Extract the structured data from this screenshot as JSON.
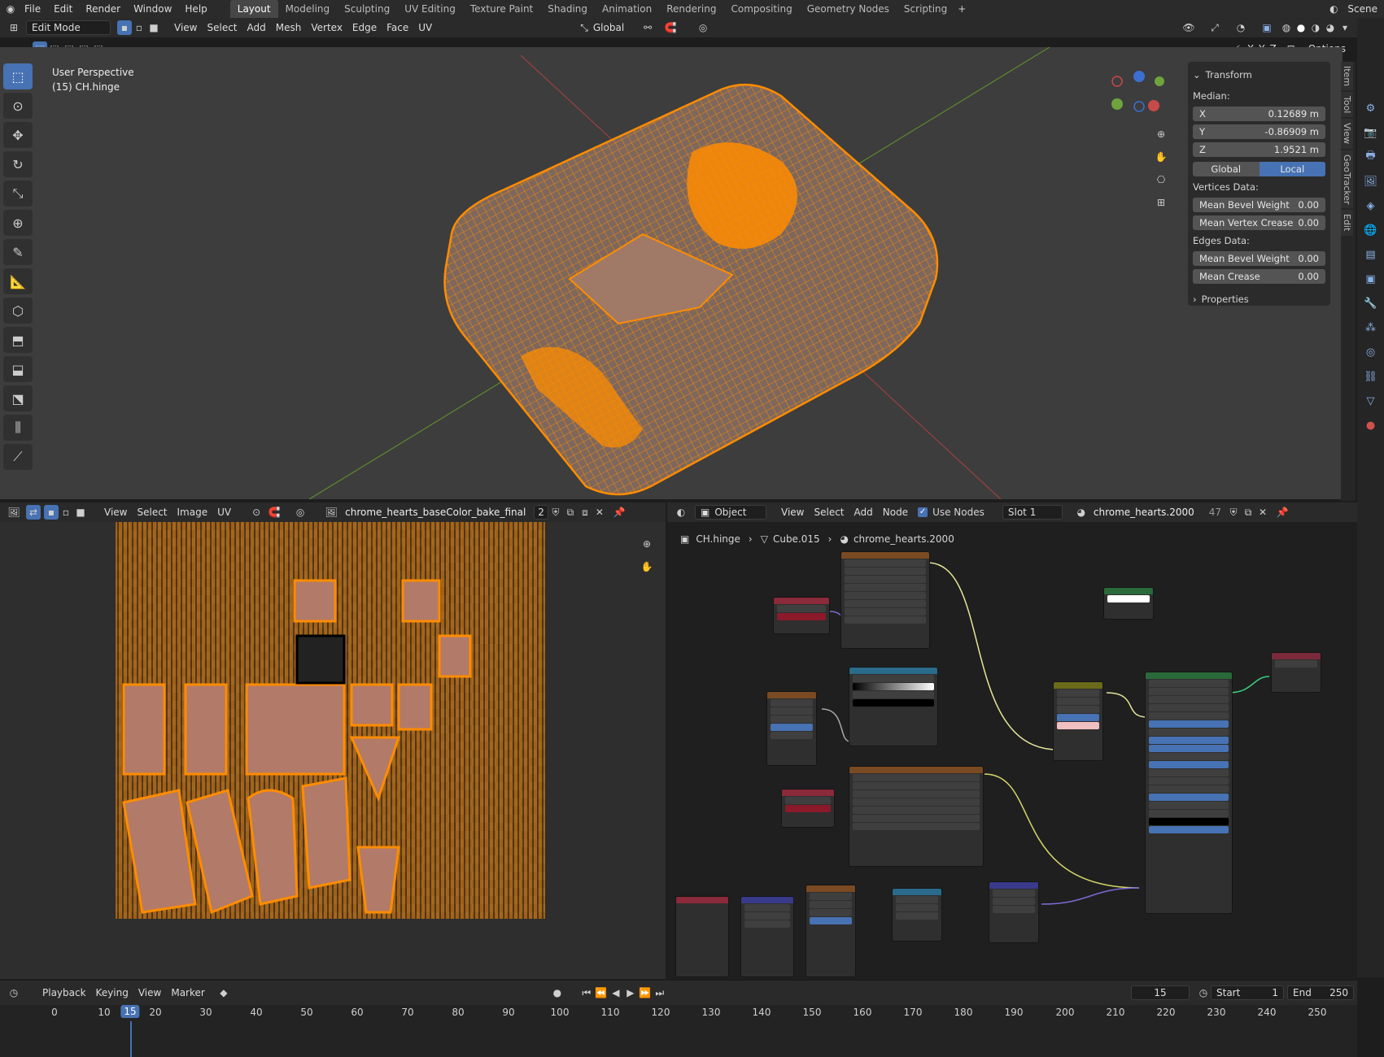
{
  "top_menu": [
    "File",
    "Edit",
    "Render",
    "Window",
    "Help"
  ],
  "workspaces": [
    {
      "label": "Layout",
      "active": true
    },
    {
      "label": "Modeling"
    },
    {
      "label": "Sculpting"
    },
    {
      "label": "UV Editing"
    },
    {
      "label": "Texture Paint"
    },
    {
      "label": "Shading"
    },
    {
      "label": "Animation"
    },
    {
      "label": "Rendering"
    },
    {
      "label": "Compositing"
    },
    {
      "label": "Geometry Nodes"
    },
    {
      "label": "Scripting"
    }
  ],
  "scene_label": "Scene",
  "viewport": {
    "mode": "Edit Mode",
    "menus": [
      "View",
      "Select",
      "Add",
      "Mesh",
      "Vertex",
      "Edge",
      "Face",
      "UV"
    ],
    "orientation": "Global",
    "options_label": "Options",
    "axis_labels": [
      "X",
      "Y",
      "Z"
    ],
    "overlay_title": "User Perspective",
    "overlay_object": "(15) CH.hinge"
  },
  "npanel": {
    "transform_title": "Transform",
    "median_label": "Median:",
    "x_label": "X",
    "x_value": "0.12689 m",
    "y_label": "Y",
    "y_value": "-0.86909 m",
    "z_label": "Z",
    "z_value": "1.9521 m",
    "global_label": "Global",
    "local_label": "Local",
    "vertices_data": "Vertices Data:",
    "mean_bevel_weight": "Mean Bevel Weight",
    "mean_bevel_weight_v": "0.00",
    "mean_vertex_crease": "Mean Vertex Crease",
    "mean_vertex_crease_v": "0.00",
    "edges_data": "Edges Data:",
    "e_mean_bevel_weight": "Mean Bevel Weight",
    "e_mean_bevel_weight_v": "0.00",
    "mean_crease": "Mean Crease",
    "mean_crease_v": "0.00",
    "properties": "Properties"
  },
  "side_tabs": [
    "Item",
    "Tool",
    "View",
    "GeoTracker",
    "Edit"
  ],
  "image_editor": {
    "menus": [
      "View",
      "Select",
      "Image",
      "UV"
    ],
    "image_name": "chrome_hearts_baseColor_bake_final",
    "users": "2"
  },
  "node_editor": {
    "type": "Object",
    "menus": [
      "View",
      "Select",
      "Add",
      "Node"
    ],
    "use_nodes": "Use Nodes",
    "slot": "Slot 1",
    "material": "chrome_hearts.2000",
    "material_users": "47",
    "breadcrumb": [
      "CH.hinge",
      "Cube.015",
      "chrome_hearts.2000"
    ]
  },
  "timeline": {
    "menus": [
      "Playback",
      "Keying",
      "View",
      "Marker"
    ],
    "current_frame": "15",
    "start_label": "Start",
    "start": "1",
    "end_label": "End",
    "end": "250",
    "ticks": [
      "0",
      "10",
      "15",
      "20",
      "30",
      "40",
      "50",
      "60",
      "70",
      "80",
      "90",
      "100",
      "110",
      "120",
      "130",
      "140",
      "150",
      "160",
      "170",
      "180",
      "190",
      "200",
      "210",
      "220",
      "230",
      "240",
      "250"
    ]
  },
  "colors": {
    "accent": "#4772b3",
    "mesh": "#ff8c00",
    "bg": "#3d3d3d"
  }
}
